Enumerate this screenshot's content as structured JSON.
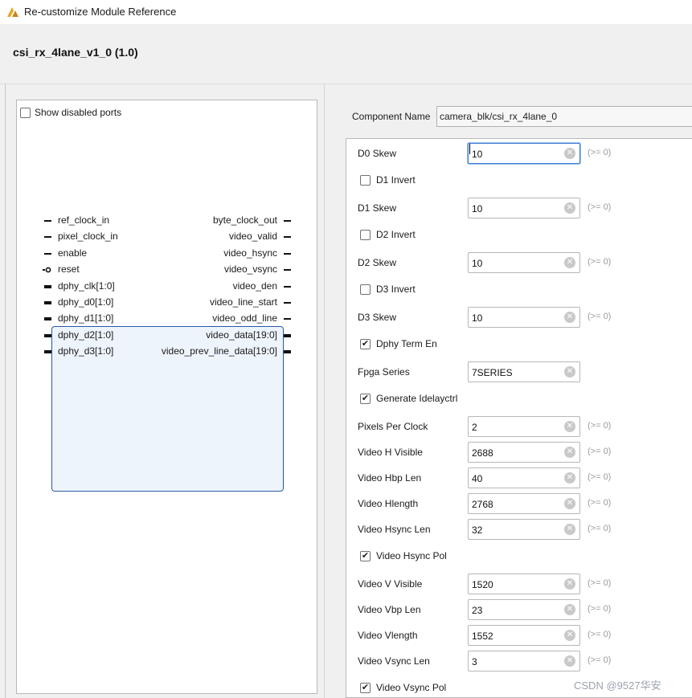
{
  "window": {
    "title": "Re-customize Module Reference"
  },
  "header": {
    "module_title": "csi_rx_4lane_v1_0 (1.0)"
  },
  "left_panel": {
    "show_disabled_ports_label": "Show disabled ports",
    "show_disabled_ports_checked": false
  },
  "block": {
    "inputs": [
      "ref_clock_in",
      "pixel_clock_in",
      "enable",
      "reset",
      "dphy_clk[1:0]",
      "dphy_d0[1:0]",
      "dphy_d1[1:0]",
      "dphy_d2[1:0]",
      "dphy_d3[1:0]"
    ],
    "outputs": [
      "byte_clock_out",
      "video_valid",
      "video_hsync",
      "video_vsync",
      "video_den",
      "video_line_start",
      "video_odd_line",
      "video_data[19:0]",
      "video_prev_line_data[19:0]"
    ]
  },
  "component": {
    "label": "Component Name",
    "value": "camera_blk/csi_rx_4lane_0"
  },
  "params": [
    {
      "type": "field",
      "label": "D0 Skew",
      "value": "10",
      "range": "(>= 0)",
      "focused": true
    },
    {
      "type": "check",
      "label": "D1 Invert",
      "checked": false
    },
    {
      "type": "field",
      "label": "D1 Skew",
      "value": "10",
      "range": "(>= 0)"
    },
    {
      "type": "check",
      "label": "D2 Invert",
      "checked": false
    },
    {
      "type": "field",
      "label": "D2 Skew",
      "value": "10",
      "range": "(>= 0)"
    },
    {
      "type": "check",
      "label": "D3 Invert",
      "checked": false
    },
    {
      "type": "field",
      "label": "D3 Skew",
      "value": "10",
      "range": "(>= 0)"
    },
    {
      "type": "check",
      "label": "Dphy Term En",
      "checked": true
    },
    {
      "type": "field",
      "label": "Fpga Series",
      "value": "7SERIES",
      "range": ""
    },
    {
      "type": "check",
      "label": "Generate Idelayctrl",
      "checked": true
    },
    {
      "type": "field",
      "label": "Pixels Per Clock",
      "value": "2",
      "range": "(>= 0)"
    },
    {
      "type": "field",
      "label": "Video H Visible",
      "value": "2688",
      "range": "(>= 0)"
    },
    {
      "type": "field",
      "label": "Video Hbp Len",
      "value": "40",
      "range": "(>= 0)"
    },
    {
      "type": "field",
      "label": "Video Hlength",
      "value": "2768",
      "range": "(>= 0)"
    },
    {
      "type": "field",
      "label": "Video Hsync Len",
      "value": "32",
      "range": "(>= 0)"
    },
    {
      "type": "check",
      "label": "Video Hsync Pol",
      "checked": true
    },
    {
      "type": "field",
      "label": "Video V Visible",
      "value": "1520",
      "range": "(>= 0)"
    },
    {
      "type": "field",
      "label": "Video Vbp Len",
      "value": "23",
      "range": "(>= 0)"
    },
    {
      "type": "field",
      "label": "Video Vlength",
      "value": "1552",
      "range": "(>= 0)"
    },
    {
      "type": "field",
      "label": "Video Vsync Len",
      "value": "3",
      "range": "(>= 0)"
    },
    {
      "type": "check",
      "label": "Video Vsync Pol",
      "checked": true
    }
  ],
  "watermark": "CSDN @9527华安",
  "colors": {
    "accent": "#3a7ad0",
    "block_fill": "#eef4fc",
    "block_border": "#2a5aa0"
  }
}
